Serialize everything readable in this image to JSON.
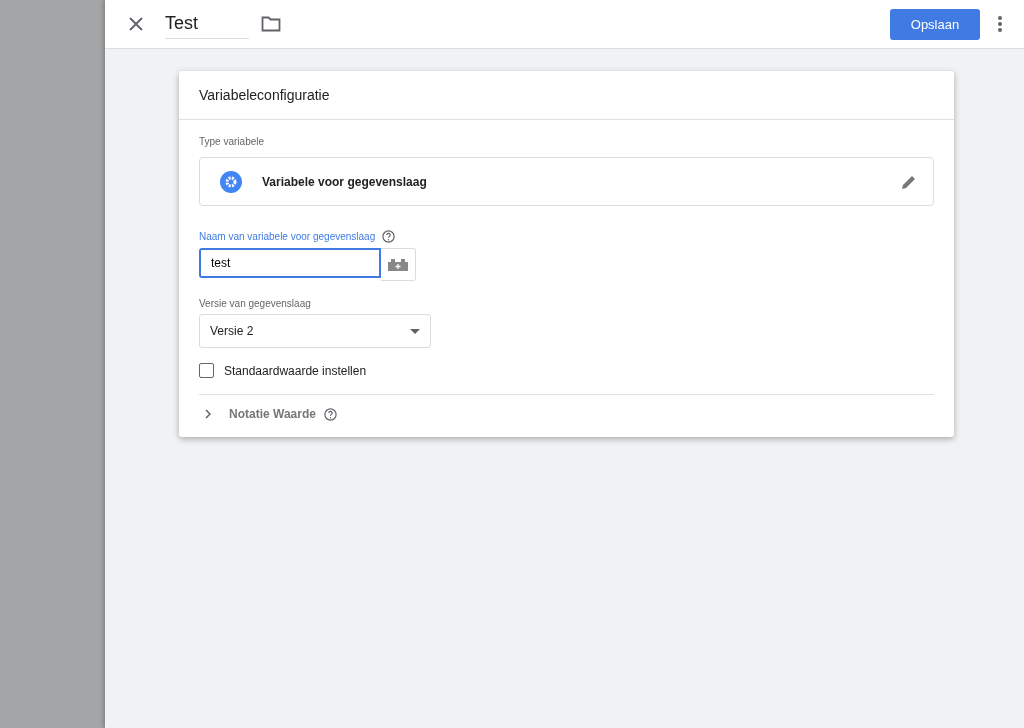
{
  "header": {
    "title": "Test",
    "save_button": "Opslaan"
  },
  "card": {
    "title": "Variabeleconfiguratie",
    "type_label": "Type variabele",
    "type_value": "Variabele voor gegevenslaag",
    "name_field": {
      "label": "Naam van variabele voor gegevenslaag",
      "value": "test",
      "focused": true
    },
    "version_field": {
      "label": "Versie van gegevenslaag",
      "value": "Versie 2"
    },
    "default_checkbox": {
      "label": "Standaardwaarde instellen",
      "checked": false
    },
    "format_section": {
      "label": "Notatie Waarde",
      "expanded": false
    }
  }
}
